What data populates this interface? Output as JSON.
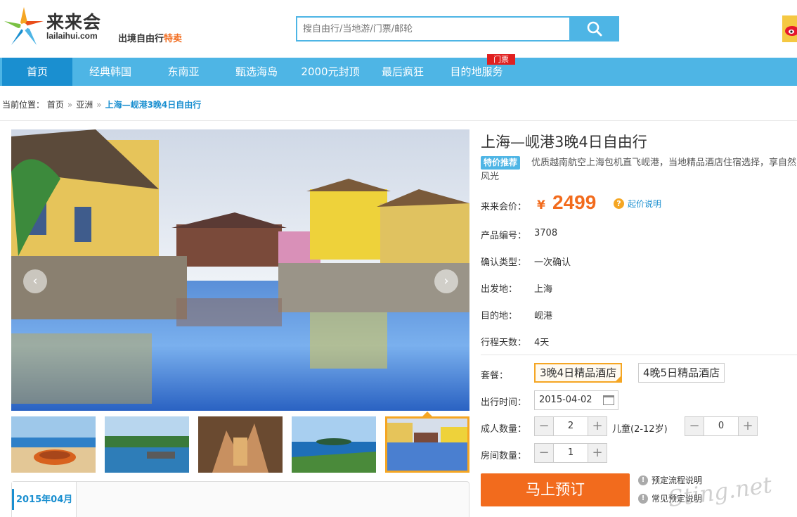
{
  "header": {
    "brand_cn": "来来会",
    "brand_en": "lailaihui.com",
    "tagline_prefix": "出境自由行",
    "tagline_highlight": "特卖",
    "search_placeholder": "搜自由行/当地游/门票/邮轮",
    "search_icon": "search-icon",
    "weibo_icon": "weibo-icon"
  },
  "nav": {
    "items": [
      "首页",
      "经典韩国",
      "东南亚",
      "甄选海岛",
      "2000元封顶",
      "最后疯狂",
      "目的地服务"
    ],
    "active": "首页",
    "badge": "门票"
  },
  "breadcrumb": {
    "label": "当前位置：",
    "items": [
      "首页",
      "亚洲",
      "上海—岘港3晚4日自由行"
    ],
    "separator": "»"
  },
  "gallery": {
    "prev_icon": "chevron-left-icon",
    "next_icon": "chevron-right-icon",
    "thumbnails": [
      "beach-boats-thumb",
      "harbor-boats-thumb",
      "cave-thumb",
      "coast-view-thumb",
      "japanese-bridge-thumb"
    ],
    "selected_thumb_index": 4
  },
  "calendar": {
    "month_tab": "2015年04月"
  },
  "product": {
    "title": "上海—岘港3晚4日自由行",
    "promo_tag": "特价推荐",
    "description": "优质越南航空上海包机直飞岘港，当地精品酒店住宿选择，享自然风光",
    "price_label": "来来会价：",
    "currency": "¥",
    "price": "2499",
    "price_help": "起价说明",
    "fields": [
      {
        "label": "产品编号：",
        "value": "3708"
      },
      {
        "label": "确认类型：",
        "value": "一次确认"
      },
      {
        "label": "出发地：",
        "value": "上海"
      },
      {
        "label": "目的地：",
        "value": "岘港"
      },
      {
        "label": "行程天数：",
        "value": "4天"
      }
    ]
  },
  "booking": {
    "package_label": "套餐：",
    "packages": [
      "3晚4日精品酒店",
      "4晚5日精品酒店"
    ],
    "selected_package_index": 0,
    "date_label": "出行时间：",
    "date_value": "2015-04-02",
    "adult_label": "成人数量：",
    "adult_value": "2",
    "child_label": "儿童(2-12岁)",
    "child_value": "0",
    "room_label": "房间数量：",
    "room_value": "1",
    "minus": "−",
    "plus": "+",
    "book_button": "马上预订",
    "link_flow": "预定流程说明",
    "link_faq": "常见预定说明"
  },
  "watermark": "Sting.net",
  "colors": {
    "nav_blue": "#4eb5e5",
    "nav_active": "#1a8fd0",
    "price_orange": "#f26b1d",
    "select_gold": "#f5a623"
  }
}
